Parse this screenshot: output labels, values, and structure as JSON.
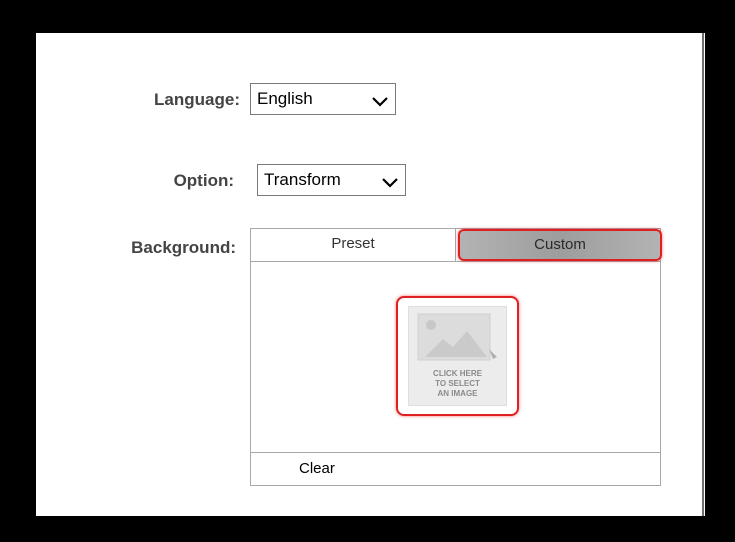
{
  "form": {
    "language_label": "Language:",
    "language_value": "English",
    "option_label": "Option:",
    "option_value": "Transform",
    "background_label": "Background:"
  },
  "background": {
    "tabs": [
      {
        "label": "Preset",
        "selected": false
      },
      {
        "label": "Custom",
        "selected": true
      }
    ],
    "image_placeholder_text": "CLICK HERE\nTO SELECT\nAN IMAGE",
    "placeholder_icon": "image-icon",
    "clear_label": "Clear"
  },
  "highlight_color": "#e02020"
}
